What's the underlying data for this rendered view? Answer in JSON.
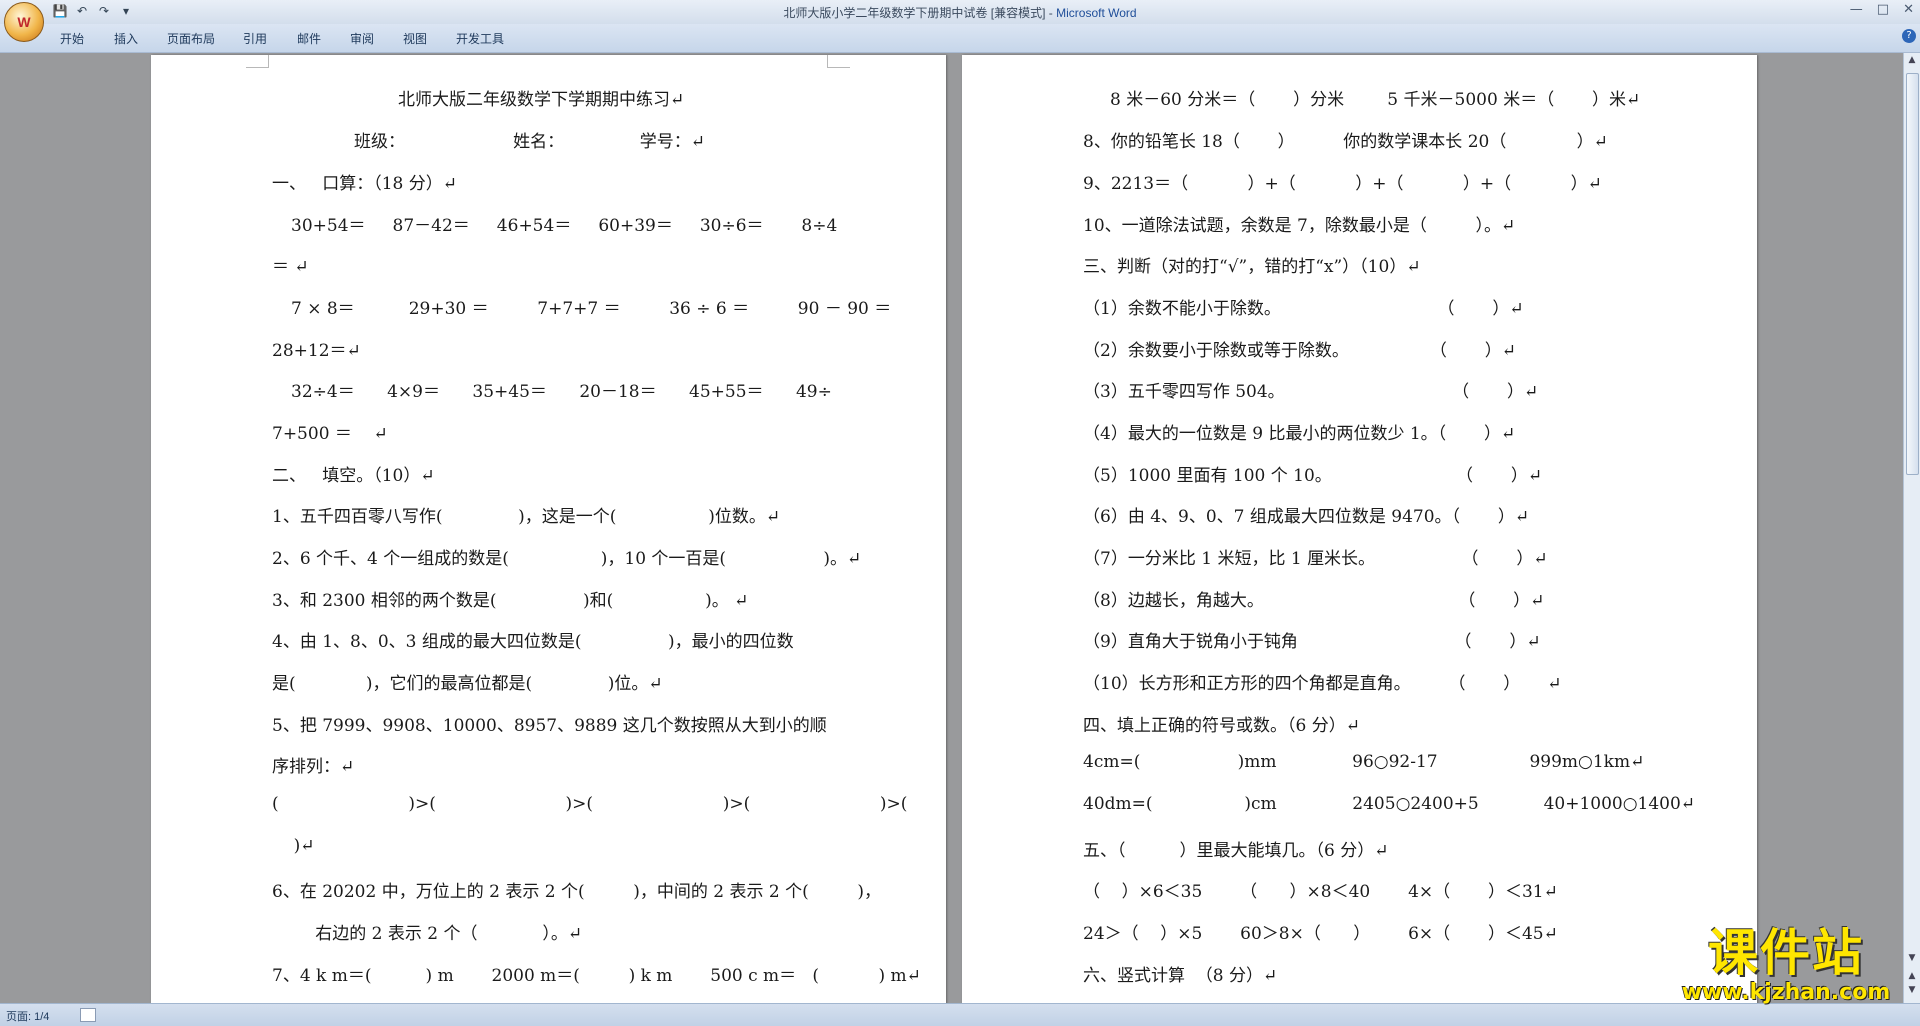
{
  "window": {
    "title": "北师大版小学二年级数学下册期中试卷 [兼容模式]",
    "app_name": "Microsoft Word",
    "office_button_label": "W"
  },
  "ribbon": {
    "tabs": [
      "开始",
      "插入",
      "页面布局",
      "引用",
      "邮件",
      "审阅",
      "视图",
      "开发工具"
    ]
  },
  "document": {
    "page1_lines": [
      "北师大版二年级数学下学期期中练习↵",
      "班级：                    姓名：              学号：↵",
      "一、   口算：（18 分）↵",
      "30+54＝     87－42＝     46+54＝     60+39＝     30÷6＝       8÷4",
      "＝ ↵",
      "7 × 8＝          29+30 ＝         7+7+7 ＝         36 ÷ 6 ＝         90 － 90 ＝",
      "28+12＝↵",
      "32÷4＝      4×9＝      35+45＝      20－18＝      45+55＝      49÷",
      "7+500 ＝    ↵",
      "二、   填空。（10）↵",
      "1、五千四百零八写作(              )，这是一个(                 )位数。↵",
      "2、6 个千、4 个一组成的数是(                 )，10 个一百是(                  )。↵",
      "3、和 2300 相邻的两个数是(                )和(                 )。 ↵",
      "4、由 1、8、0、3 组成的最大四位数是(                )，最小的四位数",
      "是(             )，它们的最高位都是(              )位。↵",
      "5、把 7999、9908、10000、8957、9889 这几个数按照从大到小的顺",
      "序排列：↵",
      "(                        )>(                        )>(                        )>(                        )>(",
      "    )↵",
      "6、在 20202 中，万位上的 2 表示 2 个(         )，中间的 2 表示 2 个(         )，",
      "        右边的 2 表示 2 个（            ）。↵",
      "7、4 k m＝(          ) m       2000 m＝(         ) k m       500 c m＝   (           ) m↵"
    ],
    "page2_lines": [
      "8 米－60 分米＝（       ）分米        5 千米－5000 米＝（       ）米↵",
      "8、你的铅笔长 18（       ）         你的数学课本长 20（             ）↵",
      "9、2213＝（           ）+（           ）+（           ）+（           ）↵",
      "10、一道除法试题，余数是 7，除数最小是（         ）。↵",
      "三、判断（对的打“√”，错的打“x”）（10）↵",
      "（1）余数不能小于除数。                             （       ）↵",
      "（2）余数要小于除数或等于除数。               （       ）↵",
      "（3）五千零四写作 504。                               （       ）↵",
      "（4）最大的一位数是 9 比最小的两位数少 1。（       ）↵",
      "（5）1000 里面有 100 个 10。                       （       ）↵",
      "（6）由 4、9、0、7 组成最大四位数是 9470。（       ）↵",
      "（7）一分米比 1 米短，比 1 厘米长。                （       ）↵",
      "（8）边越长，角越大。                                    （       ）↵",
      "（9）直角大于锐角小于钝角                             （       ）↵",
      "（10）长方形和正方形的四个角都是直角。       （       ）     ↵",
      "四、填上正确的符号或数。（6 分）↵",
      "4cm=(                  )mm              96○92-17                 999m○1km↵",
      "40dm=(                 )cm              2405○2400+5            40+1000○1400↵",
      "五、（          ）里最大能填几。（6 分）↵",
      "（    ）×6＜35       （      ）×8＜40       4×（       ）＜31↵",
      "24＞（    ）×5       60＞8×（      ）       6×（       ）＜45↵",
      "六、竖式计算  （8 分）↵"
    ]
  },
  "statusbar": {
    "page_info": "页面: 1/4"
  },
  "watermark": {
    "main": "课件站",
    "url": "www.kjzhan.com"
  }
}
